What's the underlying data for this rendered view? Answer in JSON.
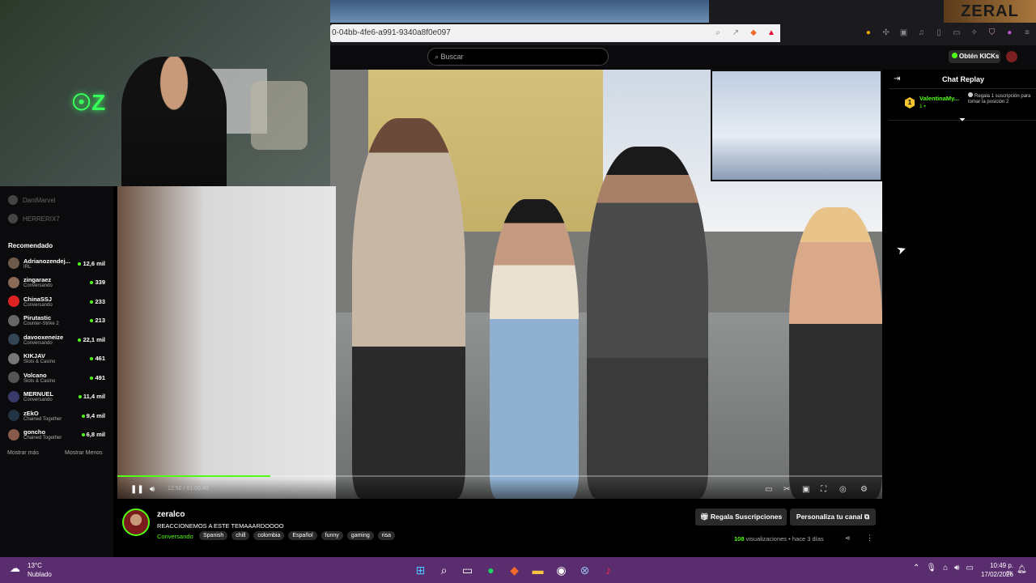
{
  "browser": {
    "url": "0-04bb-4fe6-a991-9340a8f0e097"
  },
  "overlay": {
    "logo_text": "ZERAL"
  },
  "header": {
    "search_placeholder": "Buscar",
    "kicks_label": "Obtén KICKs"
  },
  "sidebar": {
    "followed": [
      {
        "name": "DaniMarvel"
      },
      {
        "name": "HERRERIX7"
      }
    ],
    "recommended_title": "Recomendado",
    "recommended": [
      {
        "name": "Adrianozendej...",
        "category": "IRL",
        "viewers": "12,6 mil",
        "color": "#6d5a4a"
      },
      {
        "name": "zingaraez",
        "category": "Conversando",
        "viewers": "339",
        "color": "#8a6a55"
      },
      {
        "name": "ChinaSSJ",
        "category": "Conversando",
        "viewers": "233",
        "color": "#d22"
      },
      {
        "name": "Pirutastic",
        "category": "Counter-Strike 2",
        "viewers": "213",
        "color": "#666"
      },
      {
        "name": "davooxeneize",
        "category": "Conversando",
        "viewers": "22,1 mil",
        "color": "#345"
      },
      {
        "name": "KIKJAV",
        "category": "Slots & Casino",
        "viewers": "461",
        "color": "#777"
      },
      {
        "name": "Volcano",
        "category": "Slots & Casino",
        "viewers": "491",
        "color": "#555"
      },
      {
        "name": "MERNUEL",
        "category": "Conversando",
        "viewers": "11,4 mil",
        "color": "#3a3a6a"
      },
      {
        "name": "zEkO",
        "category": "Chained Together",
        "viewers": "9,4 mil",
        "color": "#234"
      },
      {
        "name": "goncho",
        "category": "Chained Together",
        "viewers": "6,8 mil",
        "color": "#8a5a4a"
      }
    ],
    "show_more": "Mostrar más",
    "show_less": "Mostrar Menos"
  },
  "player": {
    "time": "12:50 / 01:03:40",
    "progress": 0.2
  },
  "chat": {
    "title": "Chat Replay",
    "message": {
      "user": "ValentinaMy...",
      "badge": "1",
      "count": "1",
      "gift_text": "Regala 1 suscripción para tomar la posición 2"
    }
  },
  "stream": {
    "channel": "zeralco",
    "title": "REACCIONEMOS A ESTE TEMAAARDOOOO",
    "category": "Conversando",
    "tags": [
      "Spanish",
      "chill",
      "colombia",
      "Español",
      "funny",
      "gaming",
      "risa"
    ],
    "gift_button": "Regala Suscripciones",
    "customize_button": "Personaliza tu canal",
    "views_count": "108",
    "views_label": "visualizaciones",
    "age": "hace 3 días"
  },
  "taskbar": {
    "temperature": "13°C",
    "weather": "Nublado",
    "time": "10:49 p. m.",
    "date": "17/02/2026"
  },
  "colors": {
    "accent": "#53fc18",
    "taskbar": "#5a2d6e"
  }
}
